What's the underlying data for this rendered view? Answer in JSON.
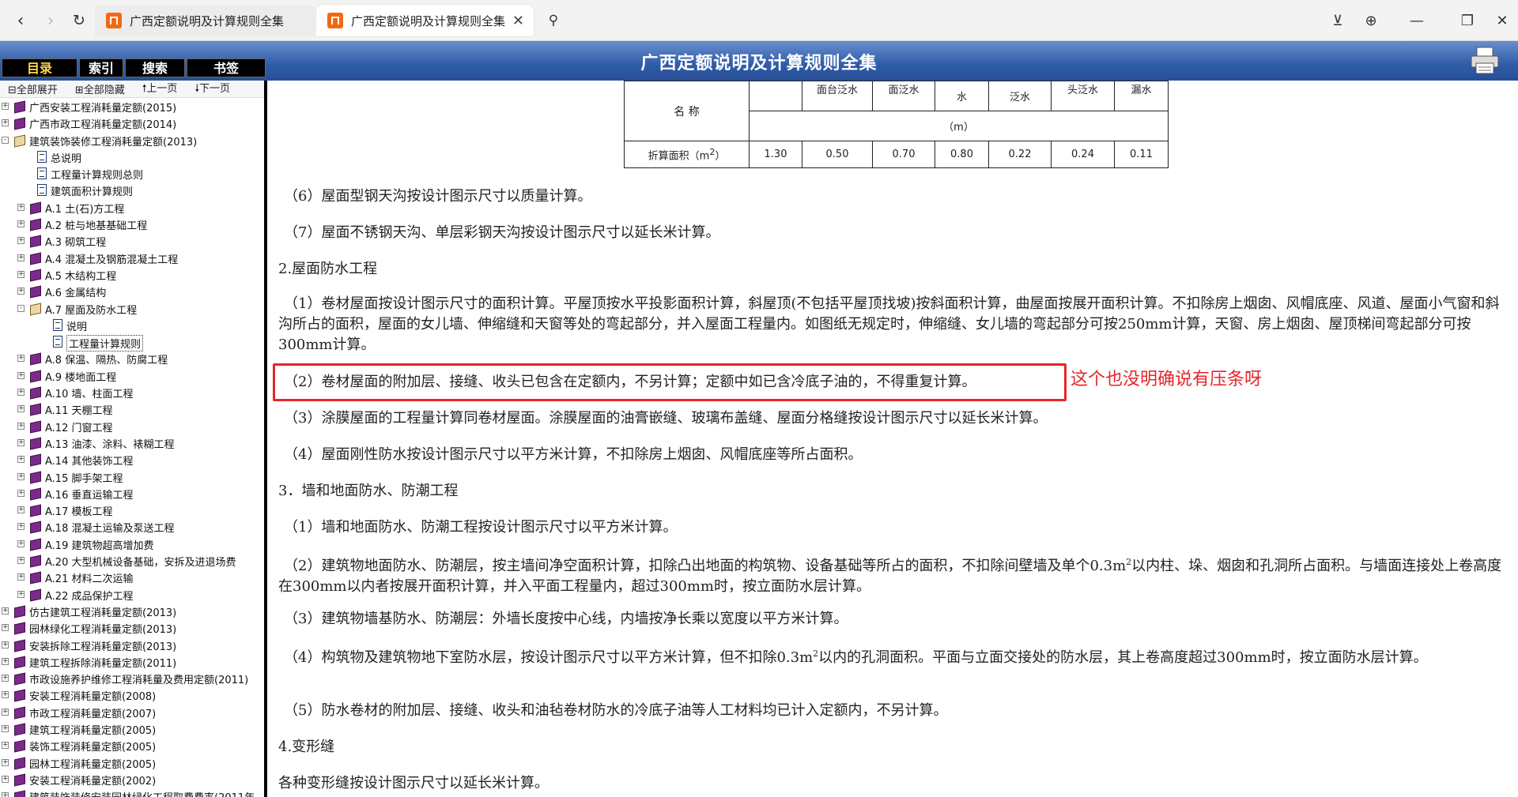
{
  "browser": {
    "tabs": [
      {
        "title": "广西定额说明及计算规则全集"
      },
      {
        "title": "广西定额说明及计算规则全集"
      }
    ]
  },
  "app": {
    "title": "广西定额说明及计算规则全集",
    "tabs": [
      "目录",
      "索引",
      "搜索",
      "书签"
    ],
    "active_tab": "目录"
  },
  "sidebar": {
    "toolbar": [
      "全部展开",
      "全部隐藏",
      "上一页",
      "下一页"
    ],
    "tree": [
      {
        "label": "广西安装工程消耗量定额(2015)",
        "level": 0,
        "type": "book",
        "expand": "+"
      },
      {
        "label": "广西市政工程消耗量定额(2014)",
        "level": 0,
        "type": "book",
        "expand": "+"
      },
      {
        "label": "建筑装饰装修工程消耗量定额(2013)",
        "level": 0,
        "type": "book-open",
        "expand": "-"
      },
      {
        "label": "总说明",
        "level": 1,
        "type": "doc"
      },
      {
        "label": "工程量计算规则总则",
        "level": 1,
        "type": "doc"
      },
      {
        "label": "建筑面积计算规则",
        "level": 1,
        "type": "doc"
      },
      {
        "label": "A.1 土(石)方工程",
        "level": 1,
        "type": "book",
        "expand": "+"
      },
      {
        "label": "A.2 桩与地基基础工程",
        "level": 1,
        "type": "book",
        "expand": "+"
      },
      {
        "label": "A.3 砌筑工程",
        "level": 1,
        "type": "book",
        "expand": "+"
      },
      {
        "label": "A.4 混凝土及钢筋混凝土工程",
        "level": 1,
        "type": "book",
        "expand": "+"
      },
      {
        "label": "A.5 木结构工程",
        "level": 1,
        "type": "book",
        "expand": "+"
      },
      {
        "label": "A.6 金属结构",
        "level": 1,
        "type": "book",
        "expand": "+"
      },
      {
        "label": "A.7 屋面及防水工程",
        "level": 1,
        "type": "book-open",
        "expand": "-"
      },
      {
        "label": "说明",
        "level": 2,
        "type": "doc"
      },
      {
        "label": "工程量计算规则",
        "level": 2,
        "type": "doc",
        "selected": true
      },
      {
        "label": "A.8 保温、隔热、防腐工程",
        "level": 1,
        "type": "book",
        "expand": "+"
      },
      {
        "label": "A.9 楼地面工程",
        "level": 1,
        "type": "book",
        "expand": "+"
      },
      {
        "label": "A.10 墙、柱面工程",
        "level": 1,
        "type": "book",
        "expand": "+"
      },
      {
        "label": "A.11 天棚工程",
        "level": 1,
        "type": "book",
        "expand": "+"
      },
      {
        "label": "A.12 门窗工程",
        "level": 1,
        "type": "book",
        "expand": "+"
      },
      {
        "label": "A.13 油漆、涂料、裱糊工程",
        "level": 1,
        "type": "book",
        "expand": "+"
      },
      {
        "label": "A.14 其他装饰工程",
        "level": 1,
        "type": "book",
        "expand": "+"
      },
      {
        "label": "A.15 脚手架工程",
        "level": 1,
        "type": "book",
        "expand": "+"
      },
      {
        "label": "A.16 垂直运输工程",
        "level": 1,
        "type": "book",
        "expand": "+"
      },
      {
        "label": "A.17 模板工程",
        "level": 1,
        "type": "book",
        "expand": "+"
      },
      {
        "label": "A.18 混凝土运输及泵送工程",
        "level": 1,
        "type": "book",
        "expand": "+"
      },
      {
        "label": "A.19 建筑物超高增加费",
        "level": 1,
        "type": "book",
        "expand": "+"
      },
      {
        "label": "A.20 大型机械设备基础，安拆及进退场费",
        "level": 1,
        "type": "book",
        "expand": "+"
      },
      {
        "label": "A.21 材料二次运输",
        "level": 1,
        "type": "book",
        "expand": "+"
      },
      {
        "label": "A.22 成品保护工程",
        "level": 1,
        "type": "book",
        "expand": "+"
      },
      {
        "label": "仿古建筑工程消耗量定额(2013)",
        "level": 0,
        "type": "book",
        "expand": "+"
      },
      {
        "label": "园林绿化工程消耗量定额(2013)",
        "level": 0,
        "type": "book",
        "expand": "+"
      },
      {
        "label": "安装拆除工程消耗量定额(2013)",
        "level": 0,
        "type": "book",
        "expand": "+"
      },
      {
        "label": "建筑工程拆除消耗量定额(2011)",
        "level": 0,
        "type": "book",
        "expand": "+"
      },
      {
        "label": "市政设施养护维修工程消耗量及费用定额(2011)",
        "level": 0,
        "type": "book",
        "expand": "+"
      },
      {
        "label": "安装工程消耗量定额(2008)",
        "level": 0,
        "type": "book",
        "expand": "+"
      },
      {
        "label": "市政工程消耗量定额(2007)",
        "level": 0,
        "type": "book",
        "expand": "+"
      },
      {
        "label": "建筑工程消耗量定额(2005)",
        "level": 0,
        "type": "book",
        "expand": "+"
      },
      {
        "label": "装饰工程消耗量定额(2005)",
        "level": 0,
        "type": "book",
        "expand": "+"
      },
      {
        "label": "园林工程消耗量定额(2005)",
        "level": 0,
        "type": "book",
        "expand": "+"
      },
      {
        "label": "安装工程消耗量定额(2002)",
        "level": 0,
        "type": "book",
        "expand": "+"
      },
      {
        "label": "建筑装饰装修安装园林绿化工程取费费率(2011年",
        "level": 0,
        "type": "book",
        "expand": "+"
      }
    ]
  },
  "table": {
    "header_name": "名  称",
    "header_top": [
      "",
      "面台泛水",
      "面泛水",
      "水",
      "泛水",
      "头泛水",
      "漏水"
    ],
    "unit": "（m）",
    "row_label": "折算面积（m",
    "row_label_sup": "2",
    "row_label_end": "）",
    "row_values": [
      "1.30",
      "0.50",
      "0.70",
      "0.80",
      "0.22",
      "0.24",
      "0.11"
    ]
  },
  "content": {
    "p1": "（6）屋面型钢天沟按设计图示尺寸以质量计算。",
    "p2": "（7）屋面不锈钢天沟、单层彩钢天沟按设计图示尺寸以延长米计算。",
    "h2": "2.屋面防水工程",
    "p3": "（1）卷材屋面按设计图示尺寸的面积计算。平屋顶按水平投影面积计算，斜屋顶(不包括平屋顶找坡)按斜面积计算，曲屋面按展开面积计算。不扣除房上烟囱、风帽底座、风道、屋面小气窗和斜沟所占的面积，屋面的女儿墙、伸缩缝和天窗等处的弯起部分，并入屋面工程量内。如图纸无规定时，伸缩缝、女儿墙的弯起部分可按250mm计算，天窗、房上烟囱、屋顶梯间弯起部分可按300mm计算。",
    "p4": "（2）卷材屋面的附加层、接缝、收头已包含在定额内，不另计算；定额中如已含冷底子油的，不得重复计算。",
    "p5": "（3）涂膜屋面的工程量计算同卷材屋面。涂膜屋面的油膏嵌缝、玻璃布盖缝、屋面分格缝按设计图示尺寸以延长米计算。",
    "p6": "（4）屋面刚性防水按设计图示尺寸以平方米计算，不扣除房上烟囱、风帽底座等所占面积。",
    "h3": "3．墙和地面防水、防潮工程",
    "p7": "（1）墙和地面防水、防潮工程按设计图示尺寸以平方米计算。",
    "p8a": "（2）建筑物地面防水、防潮层，按主墙间净空面积计算，扣除凸出地面的构筑物、设备基础等所占的面积，不扣除间壁墙及单个0.3m",
    "p8sup": "2",
    "p8b": "以内柱、垛、烟囱和孔洞所占面积。与墙面连接处上卷高度在300mm以内者按展开面积计算，并入平面工程量内，超过300mm时，按立面防水层计算。",
    "p9": "（3）建筑物墙基防水、防潮层：外墙长度按中心线，内墙按净长乘以宽度以平方米计算。",
    "p10a": "（4）构筑物及建筑物地下室防水层，按设计图示尺寸以平方米计算，但不扣除0.3m",
    "p10sup": "2",
    "p10b": "以内的孔洞面积。平面与立面交接处的防水层，其上卷高度超过300mm时，按立面防水层计算。",
    "p11": "（5）防水卷材的附加层、接缝、收头和油毡卷材防水的冷底子油等人工材料均已计入定额内，不另计算。",
    "h4": "4.变形缝",
    "p12": "各种变形缝按设计图示尺寸以延长米计算。"
  },
  "annotation": {
    "text": "这个也没明确说有压条呀",
    "color": "#e5262a"
  }
}
